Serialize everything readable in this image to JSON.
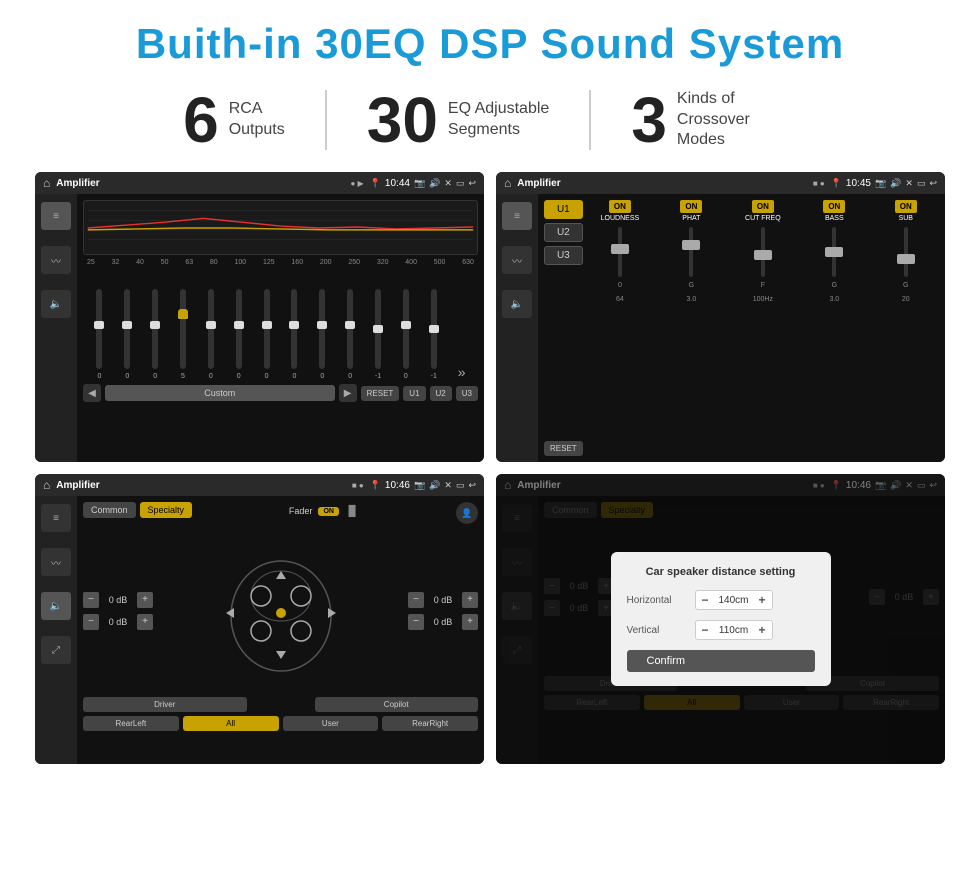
{
  "title": "Buith-in 30EQ DSP Sound System",
  "stats": [
    {
      "number": "6",
      "label": "RCA\nOutputs"
    },
    {
      "number": "30",
      "label": "EQ Adjustable\nSegments"
    },
    {
      "number": "3",
      "label": "Kinds of\nCrossover Modes"
    }
  ],
  "screens": [
    {
      "id": "eq-screen",
      "app_name": "Amplifier",
      "time": "10:44",
      "eq_freqs": [
        "25",
        "32",
        "40",
        "50",
        "63",
        "80",
        "100",
        "125",
        "160",
        "200",
        "250",
        "320",
        "400",
        "500",
        "630"
      ],
      "eq_values": [
        "0",
        "0",
        "0",
        "5",
        "0",
        "0",
        "0",
        "0",
        "0",
        "0",
        "-1",
        "0",
        "-1"
      ],
      "eq_preset": "Custom",
      "buttons": [
        "RESET",
        "U1",
        "U2",
        "U3"
      ]
    },
    {
      "id": "crossover-screen",
      "app_name": "Amplifier",
      "time": "10:45",
      "channels": [
        "U1",
        "U2",
        "U3"
      ],
      "toggles": [
        "ON",
        "ON",
        "ON",
        "ON",
        "ON"
      ],
      "labels": [
        "LOUDNESS",
        "PHAT",
        "CUT FREQ",
        "BASS",
        "SUB"
      ],
      "reset_label": "RESET"
    },
    {
      "id": "fader-screen",
      "app_name": "Amplifier",
      "time": "10:46",
      "tabs": [
        "Common",
        "Specialty"
      ],
      "fader_label": "Fader",
      "fader_on": "ON",
      "volumes": [
        "0 dB",
        "0 dB",
        "0 dB",
        "0 dB"
      ],
      "bottom_buttons": [
        "Driver",
        "",
        "Copilot",
        "RearLeft",
        "All",
        "User",
        "RearRight"
      ]
    },
    {
      "id": "distance-screen",
      "app_name": "Amplifier",
      "time": "10:46",
      "tabs": [
        "Common",
        "Specialty"
      ],
      "dialog": {
        "title": "Car speaker distance setting",
        "horizontal_label": "Horizontal",
        "horizontal_value": "140cm",
        "vertical_label": "Vertical",
        "vertical_value": "110cm",
        "confirm_label": "Confirm"
      },
      "bottom_buttons": [
        "Driver",
        "Copilot",
        "RearLeft",
        "All",
        "User",
        "RearRight"
      ]
    }
  ]
}
